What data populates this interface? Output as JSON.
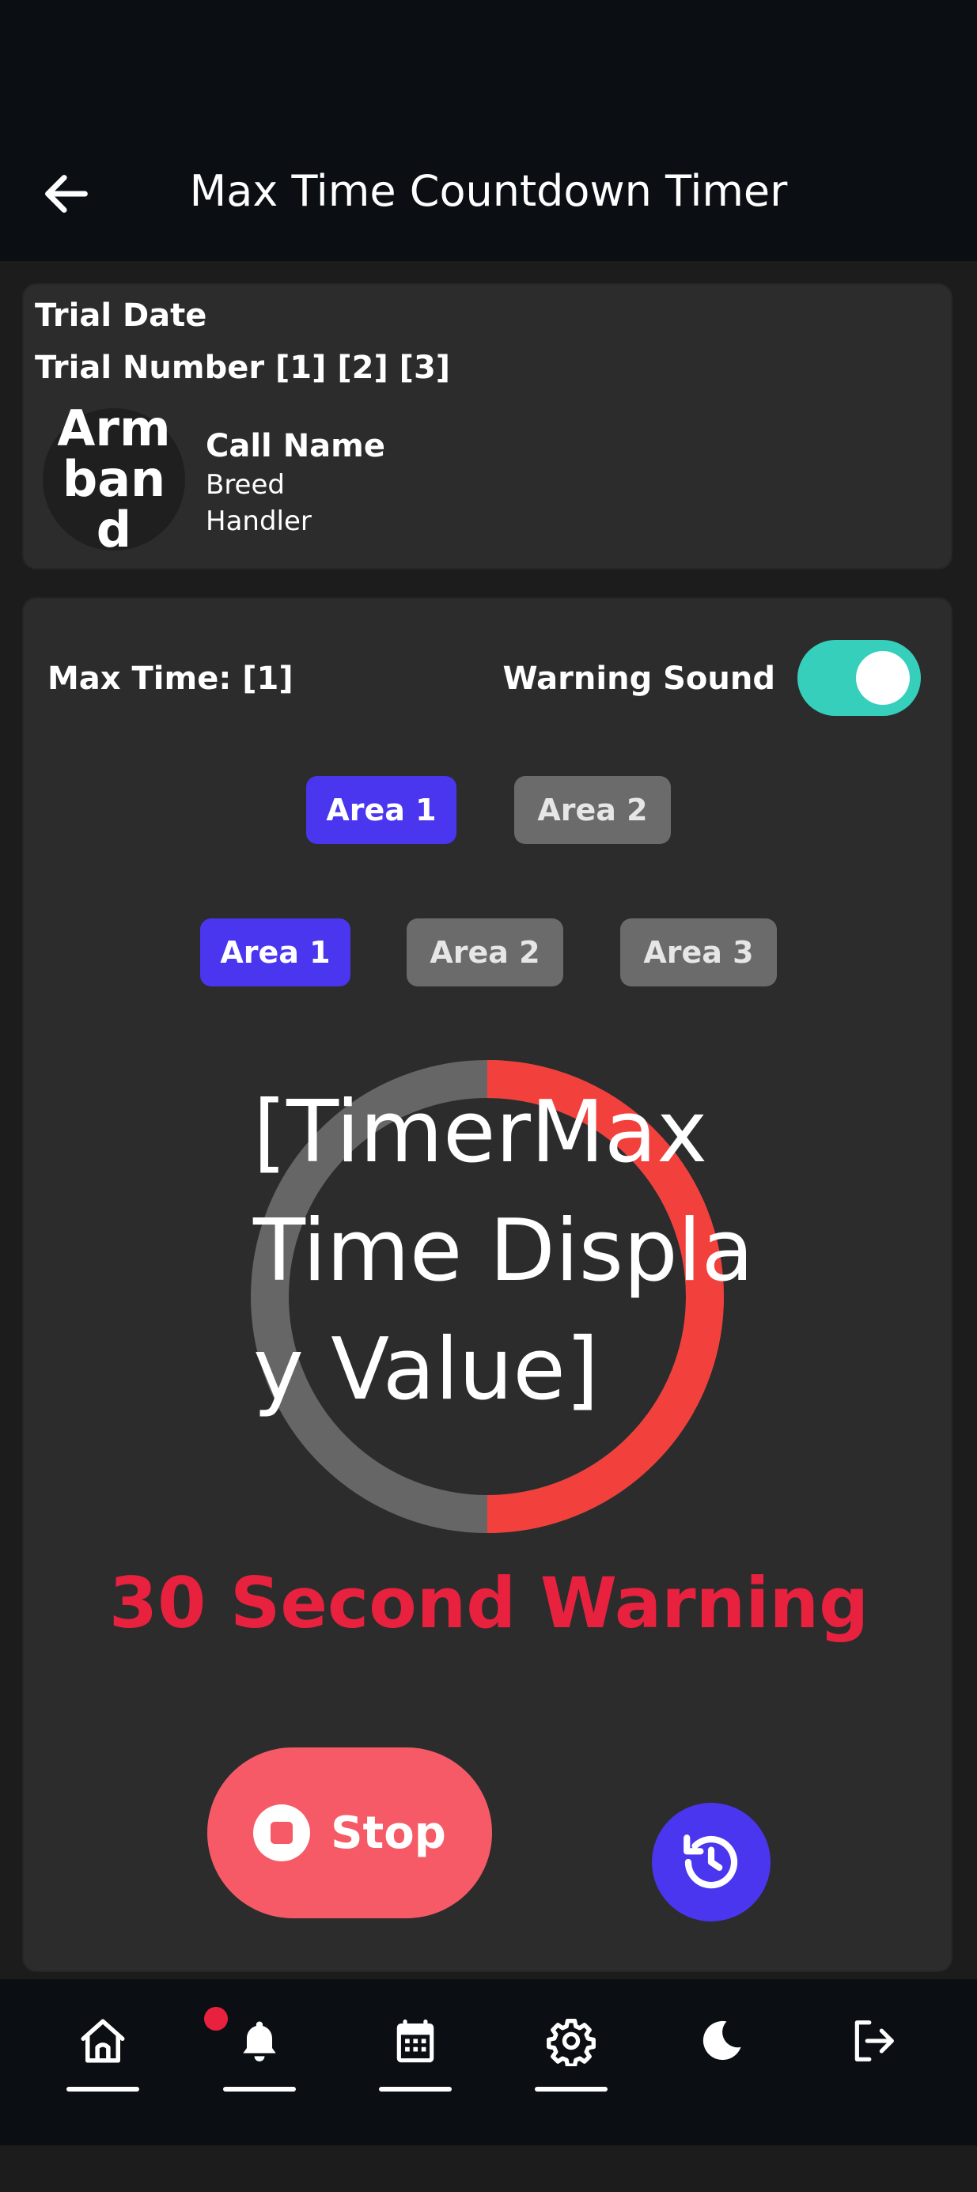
{
  "header": {
    "title": "Max Time Countdown Timer",
    "back_icon": "arrow-left-icon"
  },
  "trial_info": {
    "trial_date_label": "Trial Date",
    "trial_number_label": "Trial Number",
    "trial_number_value": "[1] [2] [3]",
    "armband": "Armband",
    "call_name": "Call Name",
    "breed": "Breed",
    "handler": "Handler"
  },
  "timer_card": {
    "max_time_label": "Max Time: [1]",
    "warning_sound_label": "Warning Sound",
    "warning_sound_on": true,
    "area_row1": [
      "Area 1",
      "Area 2"
    ],
    "area_row2": [
      "Area 1",
      "Area 2",
      "Area 3"
    ],
    "active_area_index": 0,
    "timer_display": "[TimerMax Time Display Value]",
    "progress_fraction": 0.5,
    "warning_text": "30 Second Warning",
    "stop_label": "Stop"
  },
  "bottom_nav": {
    "items": [
      "home-icon",
      "bell-icon",
      "calendar-icon",
      "gear-icon",
      "moon-icon",
      "logout-icon"
    ],
    "notification_dot": true
  },
  "colors": {
    "accent": "#4a36ee",
    "toggle_on": "#36cfbc",
    "warning": "#e8213e",
    "stop": "#f65a66",
    "ring_progress": "#f2413c",
    "ring_track": "#666666"
  }
}
